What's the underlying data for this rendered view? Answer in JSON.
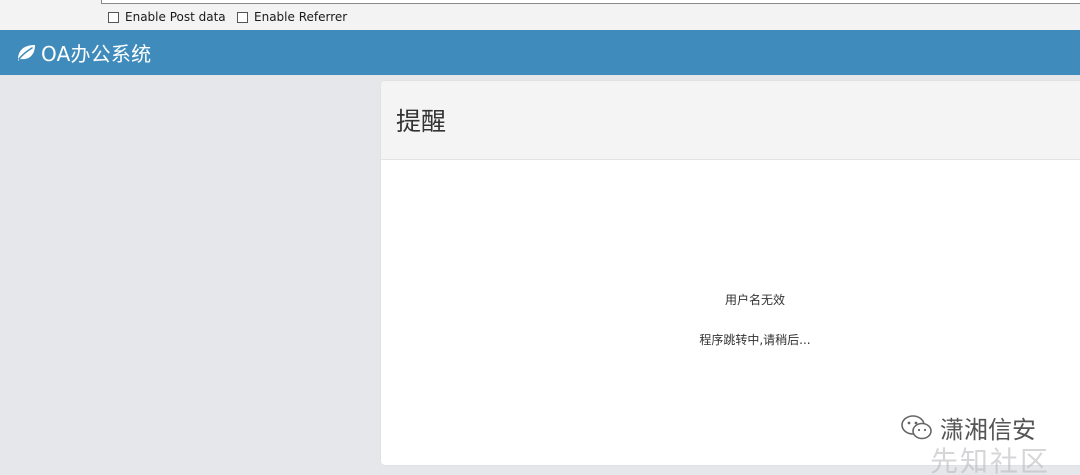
{
  "toolbar": {
    "options": [
      {
        "label": "Enable Post data",
        "checked": false
      },
      {
        "label": "Enable Referrer",
        "checked": false
      }
    ]
  },
  "header": {
    "icon": "leaf-icon",
    "title": "OA办公系统",
    "color": "#3f8cbc"
  },
  "dialog": {
    "title": "提醒",
    "message": "用户名无效",
    "redirect_note": "程序跳转中,请稍后..."
  },
  "watermark": {
    "icon": "wechat-icon",
    "text": "潇湘信安",
    "text2": "先知社区"
  }
}
